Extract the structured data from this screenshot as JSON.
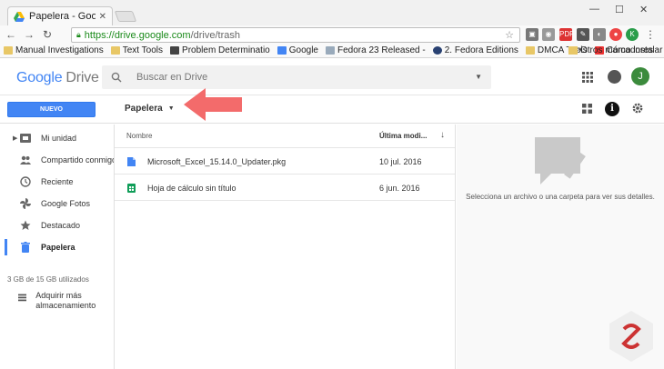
{
  "browser": {
    "tab_title": "Papelera - Google Drive",
    "url_host": "https://drive.google.com",
    "url_path": "/drive/trash",
    "bookmarks": [
      "Manual Investigations",
      "Text Tools",
      "Problem Determinatio",
      "Google",
      "Fedora 23 Released -",
      "2. Fedora Editions",
      "DMCA Tools",
      "Cómo instalar macOS"
    ],
    "more": "»",
    "other_bookmarks": "Otros marcadores"
  },
  "header": {
    "logo_google": "Google",
    "logo_drive": "Drive",
    "search_placeholder": "Buscar en Drive",
    "avatar_initial": "J"
  },
  "actions": {
    "new_label": "NUEVO",
    "breadcrumb": "Papelera"
  },
  "sidebar": {
    "items": [
      {
        "label": "Mi unidad"
      },
      {
        "label": "Compartido conmigo"
      },
      {
        "label": "Reciente"
      },
      {
        "label": "Google Fotos"
      },
      {
        "label": "Destacado"
      },
      {
        "label": "Papelera"
      }
    ],
    "storage": "3 GB de 15 GB utilizados",
    "buy_storage": "Adquirir más almacenamiento"
  },
  "list": {
    "col_name": "Nombre",
    "col_modified": "Última modi...",
    "rows": [
      {
        "name": "Microsoft_Excel_15.14.0_Updater.pkg",
        "date": "10 jul. 2016",
        "icon": "generic-file-icon"
      },
      {
        "name": "Hoja de cálculo sin título",
        "date": "6 jun. 2016",
        "icon": "spreadsheet-icon"
      }
    ]
  },
  "details": {
    "message": "Selecciona un archivo o una carpeta para ver sus detalles."
  },
  "colors": {
    "accent": "#4285f4",
    "arrow": "#f36b6b",
    "avatar": "#3b8b3c"
  }
}
